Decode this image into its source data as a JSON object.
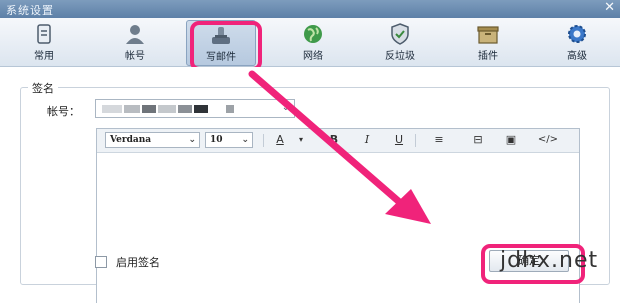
{
  "window": {
    "title": "系统设置",
    "close_glyph": "✕"
  },
  "toolbar": {
    "items": [
      {
        "label": "常用",
        "icon": "general-icon"
      },
      {
        "label": "帐号",
        "icon": "account-icon"
      },
      {
        "label": "写邮件",
        "icon": "compose-icon",
        "active": true
      },
      {
        "label": "网络",
        "icon": "network-icon"
      },
      {
        "label": "反垃圾",
        "icon": "antispam-icon"
      },
      {
        "label": "插件",
        "icon": "plugin-icon"
      },
      {
        "label": "高级",
        "icon": "advanced-icon"
      }
    ]
  },
  "signature": {
    "group_title": "签名",
    "account_label": "帐号：",
    "editor": {
      "font": "Verdana",
      "size": "10",
      "buttons": [
        "A",
        "B",
        "I",
        "U",
        "≡",
        "⊟",
        "▣",
        "</>"
      ]
    },
    "enable_label": "启用签名",
    "enable_checked": false,
    "ok_label": "确定"
  },
  "watermark": "jdhx.net",
  "colors": {
    "highlight": "#f0237a",
    "titlebar": "#6a8bb1"
  }
}
